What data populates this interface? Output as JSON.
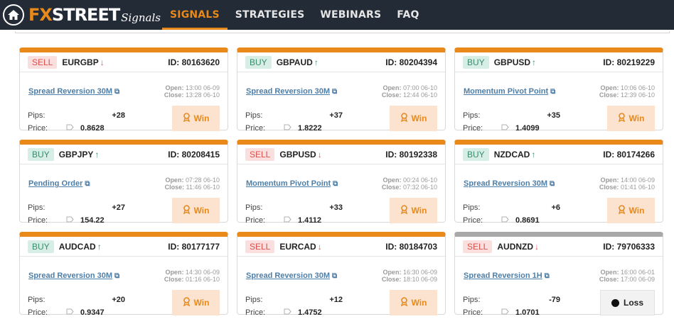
{
  "header": {
    "logo_fx": "FX",
    "logo_street": "STREET",
    "logo_signals": "Signals",
    "nav": [
      {
        "label": "SIGNALS",
        "active": true
      },
      {
        "label": "STRATEGIES",
        "active": false
      },
      {
        "label": "WEBINARS",
        "active": false
      },
      {
        "label": "FAQ",
        "active": false
      }
    ]
  },
  "labels": {
    "pips": "Pips:",
    "price": "Price:",
    "open": "Open:",
    "close": "Close:"
  },
  "colors": {
    "accent": "#e8891a",
    "sell": "#d9534f",
    "buy": "#3a8b6b",
    "link": "#4d7ea8",
    "header_bg": "#232b36"
  },
  "cards": [
    {
      "side": "SELL",
      "pair": "EURGBP",
      "direction": "down",
      "id": "ID: 80163620",
      "strategy": "Spread Reversion 30M",
      "open": "13:00 06-09",
      "close": "13:28 06-10",
      "pips": "+28",
      "price": "0.8628",
      "result": "Win"
    },
    {
      "side": "BUY",
      "pair": "GBPAUD",
      "direction": "up",
      "id": "ID: 80204394",
      "strategy": "Spread Reversion 30M",
      "open": "07:00 06-10",
      "close": "12:44 06-10",
      "pips": "+37",
      "price": "1.8222",
      "result": "Win"
    },
    {
      "side": "BUY",
      "pair": "GBPUSD",
      "direction": "up",
      "id": "ID: 80219229",
      "strategy": "Momentum Pivot Point",
      "open": "10:06 06-10",
      "close": "12:39 06-10",
      "pips": "+35",
      "price": "1.4099",
      "result": "Win"
    },
    {
      "side": "BUY",
      "pair": "GBPJPY",
      "direction": "up",
      "id": "ID: 80208415",
      "strategy": "Pending Order",
      "open": "07:28 06-10",
      "close": "11:46 06-10",
      "pips": "+27",
      "price": "154.22",
      "result": "Win"
    },
    {
      "side": "SELL",
      "pair": "GBPUSD",
      "direction": "down",
      "id": "ID: 80192338",
      "strategy": "Momentum Pivot Point",
      "open": "00:24 06-10",
      "close": "07:32 06-10",
      "pips": "+33",
      "price": "1.4112",
      "result": "Win"
    },
    {
      "side": "BUY",
      "pair": "NZDCAD",
      "direction": "up",
      "id": "ID: 80174266",
      "strategy": "Spread Reversion 30M",
      "open": "14:00 06-09",
      "close": "01:41 06-10",
      "pips": "+6",
      "price": "0.8691",
      "result": "Win"
    },
    {
      "side": "BUY",
      "pair": "AUDCAD",
      "direction": "up",
      "id": "ID: 80177177",
      "strategy": "Spread Reversion 30M",
      "open": "14:30 06-09",
      "close": "01:16 06-10",
      "pips": "+20",
      "price": "0.9347",
      "result": "Win"
    },
    {
      "side": "SELL",
      "pair": "EURCAD",
      "direction": "down",
      "id": "ID: 80184703",
      "strategy": "Spread Reversion 30M",
      "open": "16:30 06-09",
      "close": "18:10 06-09",
      "pips": "+12",
      "price": "1.4752",
      "result": "Win"
    },
    {
      "side": "SELL",
      "pair": "AUDNZD",
      "direction": "down",
      "id": "ID: 79706333",
      "strategy": "Spread Reversion 1H",
      "open": "16:00 06-01",
      "close": "17:00 06-09",
      "pips": "-79",
      "price": "1.0701",
      "result": "Loss"
    }
  ]
}
